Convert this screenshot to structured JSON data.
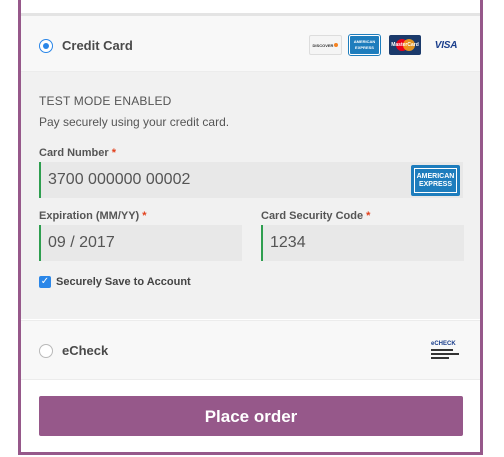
{
  "payment": {
    "credit_card_label": "Credit Card",
    "card_logos": {
      "discover": "DISCOVER",
      "amex_line1": "AMERICAN",
      "amex_line2": "EXPRESS",
      "mastercard": "MasterCard",
      "visa": "VISA"
    },
    "test_mode": "TEST MODE ENABLED",
    "description": "Pay securely using your credit card.",
    "card_number_label": "Card Number",
    "card_number_value": "3700 000000 00002",
    "expiration_label": "Expiration (MM/YY)",
    "expiration_value": "09 / 2017",
    "security_code_label": "Card Security Code",
    "security_code_value": "1234",
    "required_mark": "*",
    "save_label": "Securely Save to Account",
    "save_checked": true,
    "echeck_label": "eCheck",
    "echeck_logo": "eCHECK"
  },
  "place_order_label": "Place order",
  "colors": {
    "brand": "#96588a",
    "radio_selected": "#2a86e8",
    "valid_field": "#2e9e4f",
    "required": "#e2401c",
    "amex_blue": "#1e7dbd"
  }
}
